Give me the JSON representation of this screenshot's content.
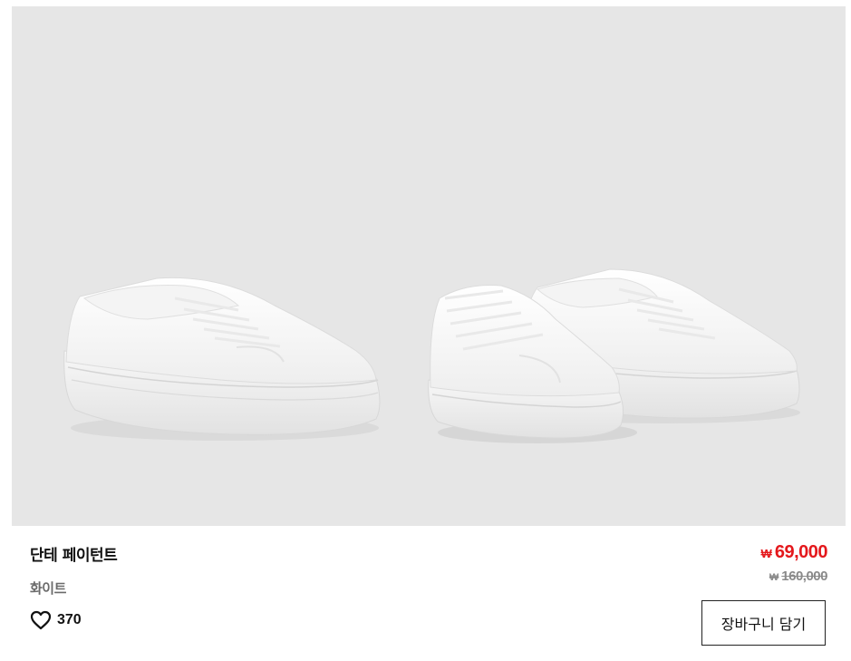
{
  "product": {
    "name": "단테 페이턴트",
    "color": "화이트",
    "like_count": "370",
    "price": {
      "sale_currency": "₩",
      "sale_amount": "69,000",
      "original_currency": "₩",
      "original_amount": "160,000"
    },
    "cart_button_label": "장바구니 담기",
    "image_background": "#e6e6e6"
  },
  "colors": {
    "sale_price": "#e4181c",
    "original_price": "#8a8a8a",
    "text": "#111111",
    "muted_text": "#6b6b6b"
  },
  "icons": {
    "like": "heart-outline-icon"
  }
}
